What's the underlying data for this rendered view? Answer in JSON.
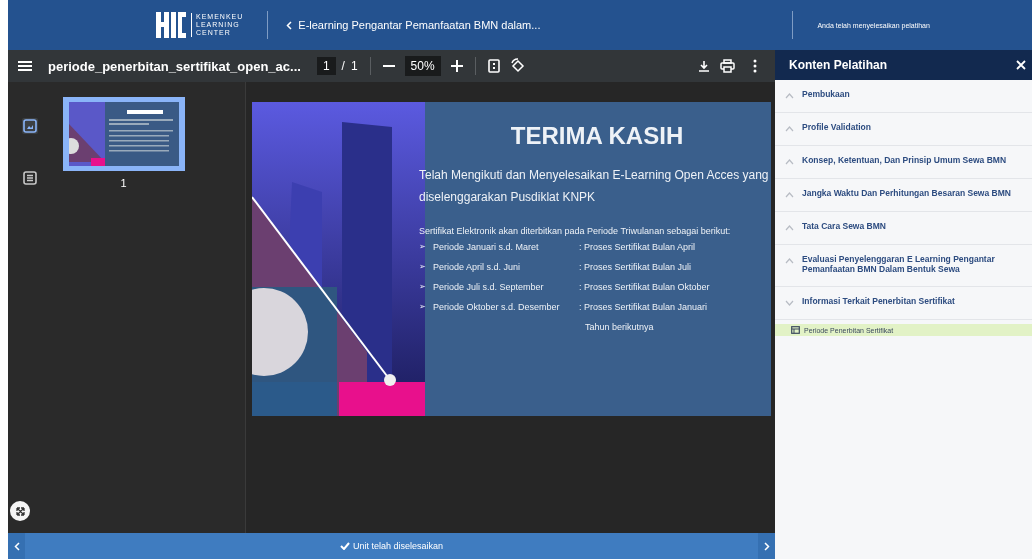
{
  "header": {
    "logo_lines": [
      "KEMENKEU",
      "LEARNING",
      "CENTER"
    ],
    "back_link": "E-learning Pengantar Pemanfaatan BMN dalam...",
    "status": "Anda telah menyelesaikan pelatihan"
  },
  "toolbar": {
    "file_name": "periode_penerbitan_sertifikat_open_ac...",
    "page_current": "1",
    "page_separator": "/",
    "page_total": "1",
    "zoom": "50%"
  },
  "side_tabs": [
    {
      "kind": "thumbnails",
      "selected": true
    },
    {
      "kind": "outline",
      "selected": false
    }
  ],
  "thumbnails": [
    {
      "label": "1",
      "selected": true
    }
  ],
  "slide": {
    "title": "TERIMA KASIH",
    "subtitle": "Telah Mengikuti dan Menyelesaikan E-Learning Open Acces yang diselenggarakan Pusdiklat KNPK",
    "intro": "Sertifikat Elektronik akan diterbitkan pada Periode Triwulanan sebagai berikut:",
    "bullet": "➢",
    "rows": [
      {
        "period": "Periode Januari s.d. Maret",
        "process": ": Proses Sertifikat Bulan April"
      },
      {
        "period": "Periode April s.d. Juni",
        "process": ": Proses Sertifikat Bulan Juli"
      },
      {
        "period": "Periode  Juli s.d. September",
        "process": ": Proses Sertifikat Bulan Oktober"
      },
      {
        "period": "Periode  Oktober s.d. Desember",
        "process": ": Proses Sertifikat Bulan Januari"
      }
    ],
    "continuation": "Tahun berikutnya"
  },
  "panel": {
    "title": "Konten Pelatihan",
    "sections": [
      {
        "label": "Pembukaan",
        "expanded": false
      },
      {
        "label": "Profile Validation",
        "expanded": false
      },
      {
        "label": "Konsep, Ketentuan, Dan Prinsip Umum Sewa BMN",
        "expanded": false
      },
      {
        "label": "Jangka Waktu Dan Perhitungan Besaran Sewa BMN",
        "expanded": false
      },
      {
        "label": "Tata Cara Sewa BMN",
        "expanded": false
      },
      {
        "label": "Evaluasi Penyelenggaran E Learning Pengantar Pemanfaatan BMN Dalam Bentuk Sewa",
        "expanded": false
      },
      {
        "label": "Informasi Terkait Penerbitan Sertifikat",
        "expanded": true,
        "children": [
          {
            "label": "Periode Penerbitan Sertifikat",
            "selected": true
          }
        ]
      }
    ]
  },
  "footer": {
    "status": "Unit telah diselesaikan"
  }
}
